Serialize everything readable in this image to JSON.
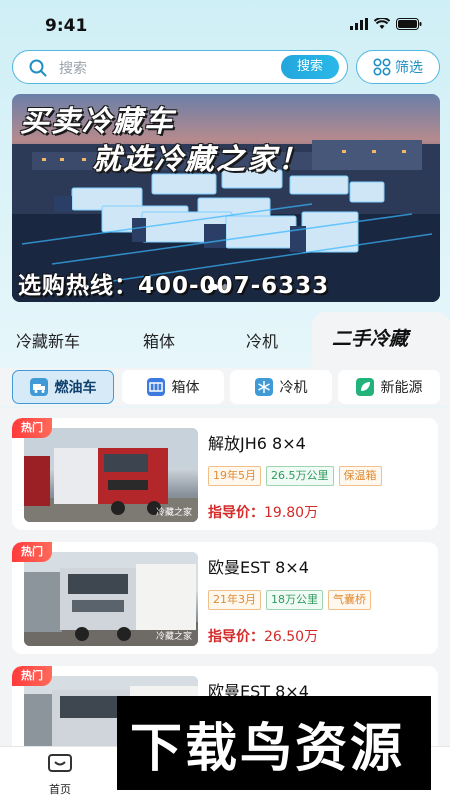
{
  "status_bar": {
    "time": "9:41"
  },
  "search": {
    "placeholder": "搜索",
    "button_label": "搜索",
    "filter_label": "筛选"
  },
  "banner": {
    "line1": "买卖冷藏车",
    "line2": "就选冷藏之家！",
    "hotline": "选购热线：400-007-6333"
  },
  "category_tabs": [
    {
      "label": "冷藏新车",
      "active": false
    },
    {
      "label": "箱体",
      "active": false
    },
    {
      "label": "冷机",
      "active": false
    },
    {
      "label": "二手冷藏",
      "active": true
    }
  ],
  "sub_tabs": [
    {
      "label": "燃油车",
      "icon": "truck-icon",
      "active": true
    },
    {
      "label": "箱体",
      "icon": "box-icon",
      "active": false
    },
    {
      "label": "冷机",
      "icon": "fridge-icon",
      "active": false
    },
    {
      "label": "新能源",
      "icon": "eco-icon",
      "active": false
    }
  ],
  "listings": [
    {
      "badge": "热门",
      "title": "解放JH6 8×4",
      "tags": [
        {
          "text": "19年5月",
          "color": "orange"
        },
        {
          "text": "26.5万公里",
          "color": "green"
        },
        {
          "text": "保温箱",
          "color": "orange"
        }
      ],
      "price_label": "指导价：",
      "price": "19.80万",
      "image_watermark": "冷藏之家"
    },
    {
      "badge": "热门",
      "title": "欧曼EST 8×4",
      "tags": [
        {
          "text": "21年3月",
          "color": "orange"
        },
        {
          "text": "18万公里",
          "color": "green"
        },
        {
          "text": "气囊桥",
          "color": "orange"
        }
      ],
      "price_label": "指导价：",
      "price": "26.50万",
      "image_watermark": "冷藏之家"
    },
    {
      "badge": "热门",
      "title": "欧曼EST 8×4",
      "tags": [],
      "price_label": "",
      "price": "",
      "image_watermark": ""
    }
  ],
  "bottom_nav": {
    "home_label": "首页"
  },
  "overlay_watermark": "下载鸟资源",
  "colors": {
    "accent": "#22a6dd",
    "hot_badge": "#ff3b3b",
    "price": "#d42a2a",
    "tag_orange": "#e08a33",
    "tag_green": "#2e9a5c"
  }
}
